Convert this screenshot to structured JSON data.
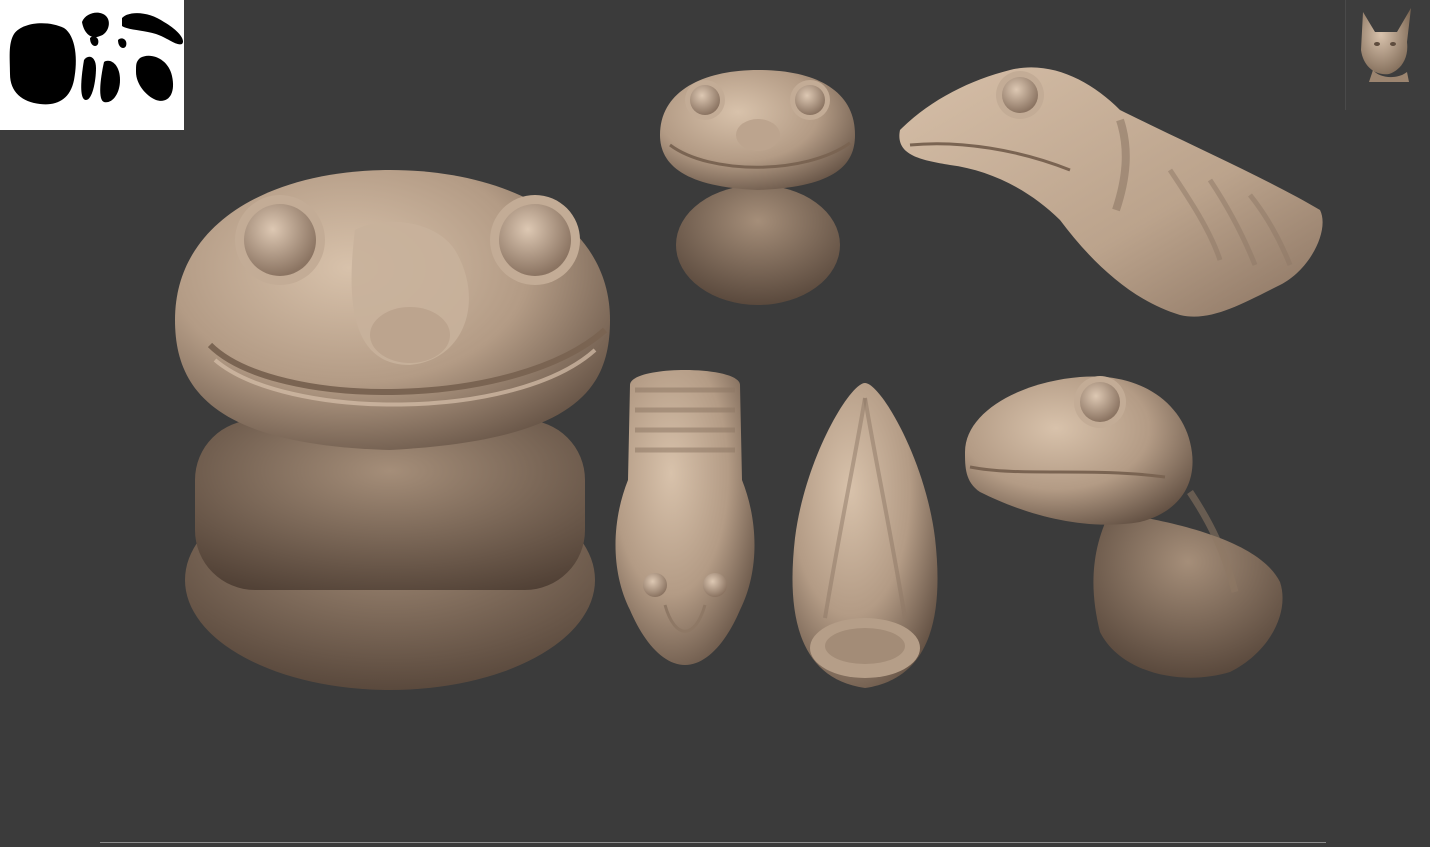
{
  "viewport": {
    "background_color": "#3b3b3b",
    "clay_color": "#c9b29c",
    "clay_shadow_color": "#6e5a4a"
  },
  "thumbnails": {
    "mask_icon": "mask-silhouette-icon",
    "model_icon": "cat-head-icon"
  },
  "views": [
    {
      "name": "front-view-large",
      "icon": "lizard-head-front"
    },
    {
      "name": "front-view-small",
      "icon": "lizard-head-front"
    },
    {
      "name": "side-view",
      "icon": "lizard-head-side"
    },
    {
      "name": "top-view",
      "icon": "lizard-head-top"
    },
    {
      "name": "bottom-view",
      "icon": "lizard-head-bottom"
    },
    {
      "name": "three-quarter-view",
      "icon": "lizard-head-three-quarter"
    }
  ]
}
